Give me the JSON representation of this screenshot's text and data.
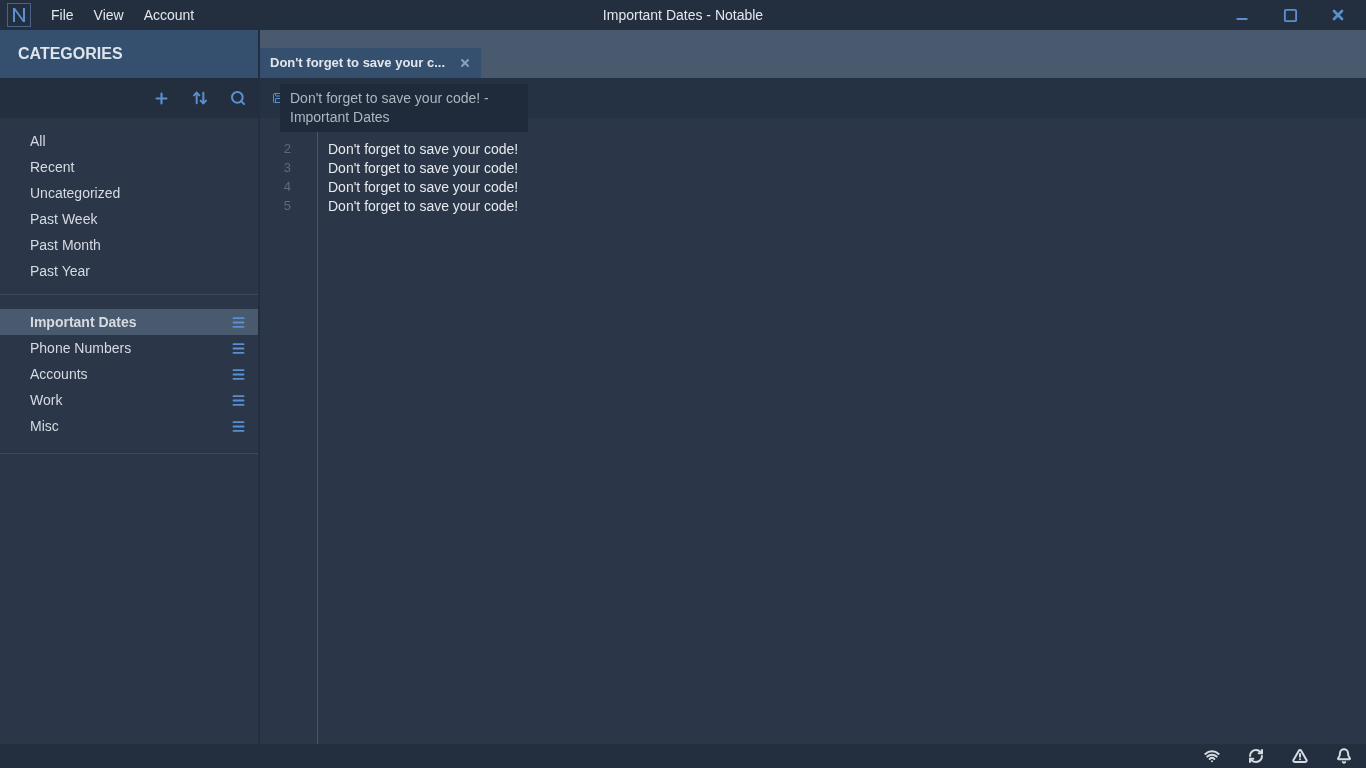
{
  "window": {
    "title": "Important Dates - Notable",
    "menu": [
      "File",
      "View",
      "Account"
    ]
  },
  "sidebar": {
    "title": "CATEGORIES",
    "filters": [
      {
        "label": "All",
        "selected": false
      },
      {
        "label": "Recent",
        "selected": false
      },
      {
        "label": "Uncategorized",
        "selected": false
      },
      {
        "label": "Past Week",
        "selected": false
      },
      {
        "label": "Past Month",
        "selected": false
      },
      {
        "label": "Past Year",
        "selected": false
      }
    ],
    "categories": [
      {
        "label": "Important Dates",
        "selected": true
      },
      {
        "label": "Phone Numbers",
        "selected": false
      },
      {
        "label": "Accounts",
        "selected": false
      },
      {
        "label": "Work",
        "selected": false
      },
      {
        "label": "Misc",
        "selected": false
      }
    ]
  },
  "tabs": [
    {
      "label": "Don't forget to save your c...",
      "selected": true
    }
  ],
  "tooltip": {
    "lines": [
      "Don't forget to save your code! -",
      "Important Dates"
    ]
  },
  "editor": {
    "lines": [
      {
        "number": "2",
        "text": "Don't forget to save your code!"
      },
      {
        "number": "3",
        "text": "Don't forget to save your code!"
      },
      {
        "number": "4",
        "text": "Don't forget to save your code!"
      },
      {
        "number": "5",
        "text": "Don't forget to save your code!"
      }
    ]
  }
}
